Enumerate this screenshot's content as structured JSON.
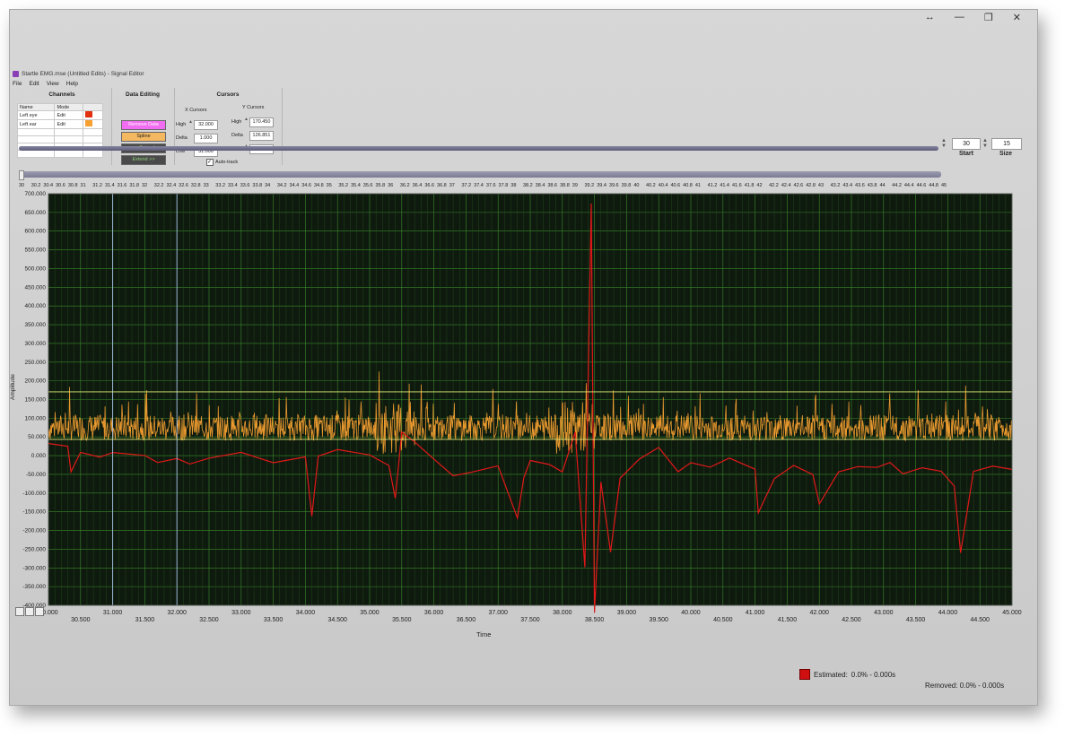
{
  "window": {
    "title": "Startle EMG.mse (Untitled Edits) - Signal Editor",
    "caption_buttons": [
      "↔",
      "—",
      "❐",
      "✕"
    ]
  },
  "menu": [
    "File",
    "Edit",
    "View",
    "Help"
  ],
  "channels": {
    "title": "Channels",
    "headers": [
      "Name",
      "Mode"
    ],
    "rows": [
      {
        "name": "Left eye",
        "mode": "Edit",
        "color": "#e03010"
      },
      {
        "name": "Left ear",
        "mode": "Edit",
        "color": "#f5a030"
      }
    ]
  },
  "data_editing": {
    "title": "Data Editing",
    "buttons": [
      "Remove Data",
      "Spline",
      "<< Extend",
      "Extend >>"
    ]
  },
  "cursors": {
    "title": "Cursors",
    "x": {
      "label": "X Cursors",
      "high_label": "High",
      "high": "32.000",
      "delta_label": "Delta",
      "delta": "1.000",
      "low_label": "Low",
      "low": "31.000"
    },
    "y": {
      "label": "Y Cursors",
      "high_label": "High",
      "high": "170.450",
      "delta_label": "Delta",
      "delta": "126.851",
      "low_label": "Low",
      "low": "43.600"
    },
    "autotrack_label": "Auto-track",
    "autotrack_checked": true
  },
  "range": {
    "start_label": "Start",
    "start": "30",
    "size_label": "Size",
    "size": "15"
  },
  "overview_ticks": [
    "30",
    "30.2",
    "30.4",
    "30.6",
    "30.8",
    "31",
    "31.2",
    "31.4",
    "31.6",
    "31.8",
    "32",
    "32.2",
    "32.4",
    "32.6",
    "32.8",
    "33",
    "33.2",
    "33.4",
    "33.6",
    "33.8",
    "34",
    "34.2",
    "34.4",
    "34.6",
    "34.8",
    "35",
    "35.2",
    "35.4",
    "35.6",
    "35.8",
    "36",
    "36.2",
    "36.4",
    "36.6",
    "36.8",
    "37",
    "37.2",
    "37.4",
    "37.6",
    "37.8",
    "38",
    "38.2",
    "38.4",
    "38.6",
    "38.8",
    "39",
    "39.2",
    "39.4",
    "39.6",
    "39.8",
    "40",
    "40.2",
    "40.4",
    "40.6",
    "40.8",
    "41",
    "41.2",
    "41.4",
    "41.6",
    "41.8",
    "42",
    "42.2",
    "42.4",
    "42.6",
    "42.8",
    "43",
    "43.2",
    "43.4",
    "43.6",
    "43.8",
    "44",
    "44.2",
    "44.4",
    "44.6",
    "44.8",
    "45"
  ],
  "chart_data": {
    "type": "line",
    "xlabel": "Time",
    "ylabel": "Amplitude",
    "xlim": [
      30,
      45
    ],
    "ylim": [
      -400,
      700
    ],
    "x_ticks": [
      "30.000",
      "30.500",
      "31.000",
      "31.500",
      "32.000",
      "32.500",
      "33.000",
      "33.500",
      "34.000",
      "34.500",
      "35.000",
      "35.500",
      "36.000",
      "36.500",
      "37.000",
      "37.500",
      "38.000",
      "38.500",
      "39.000",
      "39.500",
      "40.000",
      "40.500",
      "41.000",
      "41.500",
      "42.000",
      "42.500",
      "43.000",
      "43.500",
      "44.000",
      "44.500",
      "45.000"
    ],
    "y_ticks": [
      "700.000",
      "650.000",
      "600.000",
      "550.000",
      "500.000",
      "450.000",
      "400.000",
      "350.000",
      "300.000",
      "250.000",
      "200.000",
      "150.000",
      "100.000",
      "50.000",
      "0.000",
      "-50.000",
      "-100.000",
      "-150.000",
      "-200.000",
      "-250.000",
      "-300.000",
      "-350.000",
      "-400.000"
    ],
    "grid": true,
    "background": "#0f1a0f",
    "grid_color": "#3a8a2a",
    "cursors": {
      "x": [
        31.0,
        32.0
      ],
      "y": [
        170.45,
        43.6
      ]
    },
    "series": [
      {
        "name": "Left ear",
        "color": "#f5a030",
        "baseline": 75,
        "spike": {
          "x": 38.47,
          "peak": 670,
          "trough": -440
        },
        "points": [
          [
            30.0,
            75
          ],
          [
            30.5,
            80
          ],
          [
            31.0,
            70
          ],
          [
            31.5,
            85
          ],
          [
            32.0,
            70
          ],
          [
            32.5,
            78
          ],
          [
            33.0,
            72
          ],
          [
            33.5,
            80
          ],
          [
            34.0,
            75
          ],
          [
            34.5,
            70
          ],
          [
            35.0,
            80
          ],
          [
            35.5,
            95
          ],
          [
            36.0,
            80
          ],
          [
            36.5,
            72
          ],
          [
            37.0,
            75
          ],
          [
            37.5,
            70
          ],
          [
            38.0,
            90
          ],
          [
            38.47,
            670
          ],
          [
            38.5,
            80
          ],
          [
            39.0,
            72
          ],
          [
            39.5,
            78
          ],
          [
            40.0,
            70
          ],
          [
            40.5,
            72
          ],
          [
            41.0,
            75
          ],
          [
            41.5,
            70
          ],
          [
            42.0,
            73
          ],
          [
            42.5,
            70
          ],
          [
            43.0,
            72
          ],
          [
            43.5,
            70
          ],
          [
            44.0,
            75
          ],
          [
            44.5,
            70
          ],
          [
            45.0,
            72
          ]
        ]
      },
      {
        "name": "Left eye",
        "color": "#e01818",
        "points": [
          [
            30.0,
            30
          ],
          [
            30.3,
            25
          ],
          [
            30.35,
            -40
          ],
          [
            30.5,
            10
          ],
          [
            30.8,
            0
          ],
          [
            31.0,
            10
          ],
          [
            31.5,
            0
          ],
          [
            31.7,
            -20
          ],
          [
            32.0,
            -10
          ],
          [
            32.2,
            -25
          ],
          [
            32.5,
            -10
          ],
          [
            33.0,
            5
          ],
          [
            33.5,
            -20
          ],
          [
            34.0,
            0
          ],
          [
            34.1,
            -160
          ],
          [
            34.2,
            0
          ],
          [
            34.5,
            15
          ],
          [
            35.0,
            5
          ],
          [
            35.3,
            -25
          ],
          [
            35.4,
            -110
          ],
          [
            35.5,
            60
          ],
          [
            35.7,
            40
          ],
          [
            36.0,
            -10
          ],
          [
            36.3,
            -50
          ],
          [
            36.6,
            -40
          ],
          [
            37.0,
            -30
          ],
          [
            37.3,
            -170
          ],
          [
            37.4,
            -60
          ],
          [
            37.5,
            -10
          ],
          [
            37.8,
            -20
          ],
          [
            38.0,
            -40
          ],
          [
            38.2,
            60
          ],
          [
            38.35,
            -300
          ],
          [
            38.45,
            670
          ],
          [
            38.5,
            -420
          ],
          [
            38.6,
            -70
          ],
          [
            38.75,
            -260
          ],
          [
            38.9,
            -60
          ],
          [
            39.2,
            -10
          ],
          [
            39.5,
            20
          ],
          [
            39.8,
            -40
          ],
          [
            40.0,
            -20
          ],
          [
            40.3,
            -30
          ],
          [
            40.6,
            -10
          ],
          [
            41.0,
            -40
          ],
          [
            41.05,
            -150
          ],
          [
            41.3,
            -60
          ],
          [
            41.6,
            -30
          ],
          [
            41.9,
            -50
          ],
          [
            42.0,
            -130
          ],
          [
            42.3,
            -40
          ],
          [
            42.6,
            -30
          ],
          [
            42.9,
            -30
          ],
          [
            43.1,
            -20
          ],
          [
            43.3,
            -45
          ],
          [
            43.6,
            -35
          ],
          [
            43.9,
            -40
          ],
          [
            44.1,
            -80
          ],
          [
            44.2,
            -260
          ],
          [
            44.4,
            -40
          ],
          [
            44.7,
            -30
          ],
          [
            45.0,
            -40
          ]
        ]
      }
    ]
  },
  "status": {
    "estimated_label": "Estimated:",
    "estimated_value": "0.0% - 0.000s",
    "removed_label": "Removed:",
    "removed_value": "0.0% - 0.000s"
  }
}
